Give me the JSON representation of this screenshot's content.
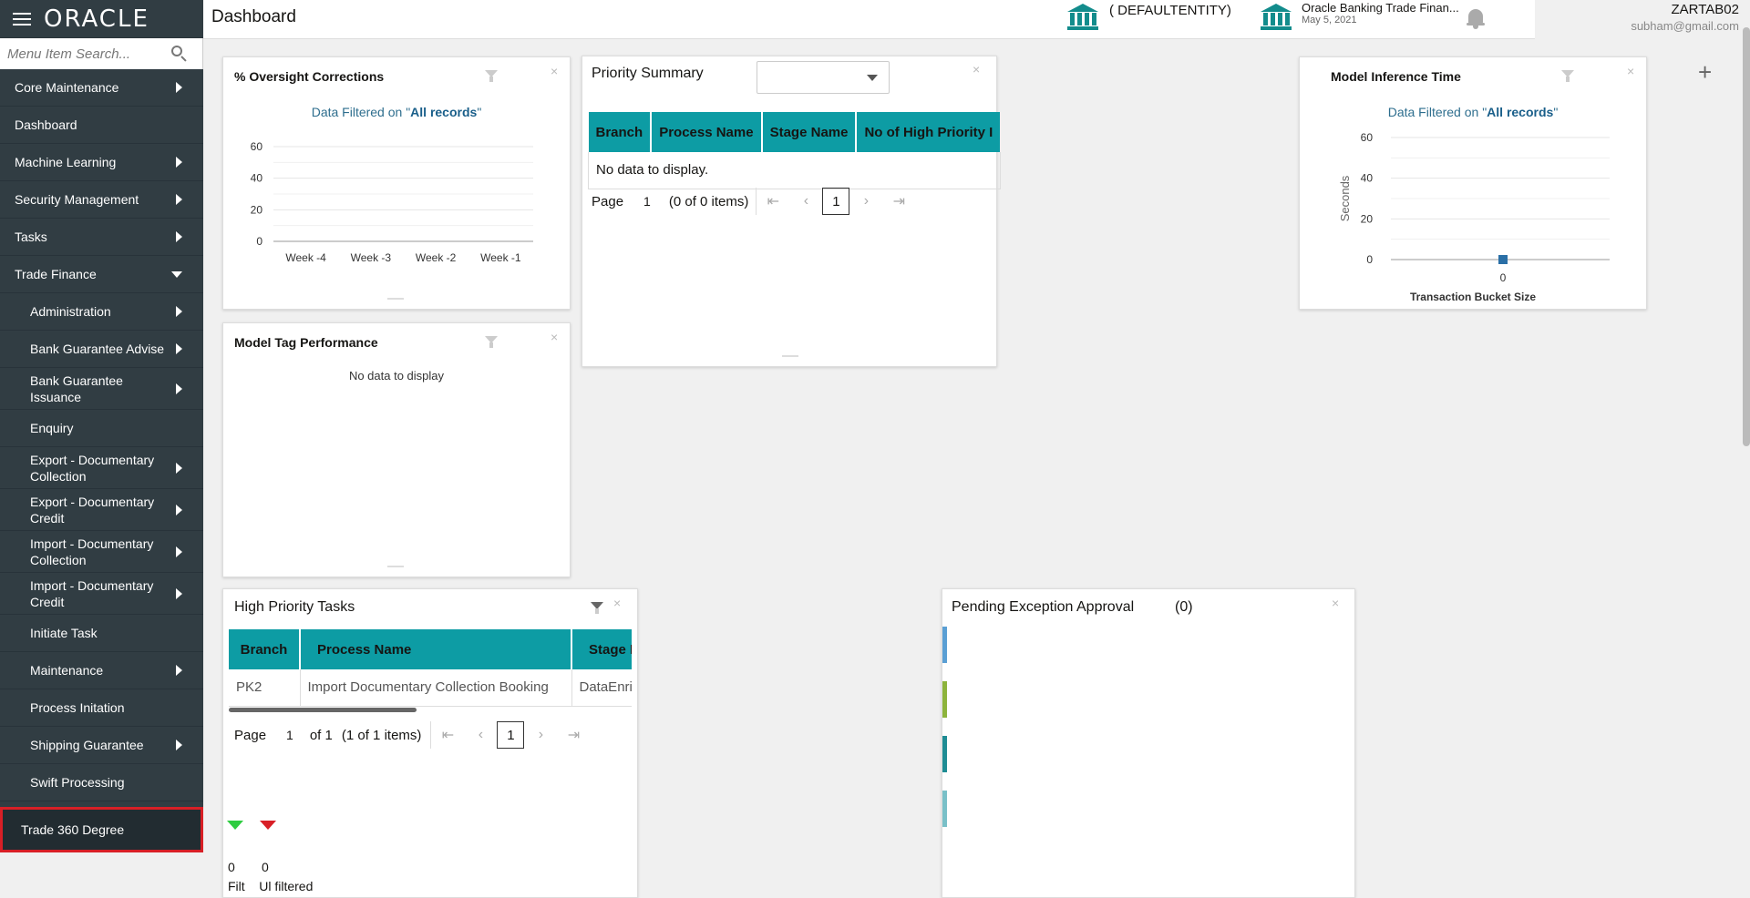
{
  "brand": {
    "logo": "ORACLE"
  },
  "search": {
    "placeholder": "Menu Item Search..."
  },
  "sidebar": {
    "items": [
      {
        "label": "Core Maintenance"
      },
      {
        "label": "Dashboard"
      },
      {
        "label": "Machine Learning"
      },
      {
        "label": "Security Management"
      },
      {
        "label": "Tasks"
      },
      {
        "label": "Trade Finance"
      },
      {
        "label": "Administration"
      },
      {
        "label": "Bank Guarantee Advise"
      },
      {
        "label": "Bank Guarantee Issuance"
      },
      {
        "label": "Enquiry"
      },
      {
        "label": "Export - Documentary Collection"
      },
      {
        "label": "Export - Documentary Credit"
      },
      {
        "label": "Import - Documentary Collection"
      },
      {
        "label": "Import - Documentary Credit"
      },
      {
        "label": "Initiate Task"
      },
      {
        "label": "Maintenance"
      },
      {
        "label": "Process Initation"
      },
      {
        "label": "Shipping Guarantee"
      },
      {
        "label": "Swift Processing"
      },
      {
        "label": "Trade 360 Degree"
      }
    ]
  },
  "header": {
    "title": "Dashboard",
    "entity": "( DEFAULTENTITY)",
    "app_name": "Oracle Banking Trade Finan...",
    "app_date": "May 5, 2021",
    "user_name": "ZARTAB02",
    "user_email": "subham@gmail.com"
  },
  "oversight": {
    "title": "% Oversight Corrections",
    "filtered_prefix": "Data Filtered on \"",
    "filtered_value": "All records",
    "filtered_suffix": "\"",
    "chart_data": {
      "type": "line",
      "categories": [
        "Week -4",
        "Week -3",
        "Week -2",
        "Week -1"
      ],
      "series": [],
      "y_ticks": [
        "0",
        "20",
        "40",
        "60"
      ],
      "ylim": [
        0,
        60
      ]
    }
  },
  "priority_summary": {
    "title": "Priority Summary",
    "columns": [
      "Branch",
      "Process Name",
      "Stage Name",
      "No of High Priority I"
    ],
    "no_data": "No data to display.",
    "page_label": "Page",
    "page_num": "1",
    "items_text": "(0 of 0 items)",
    "current_page": "1"
  },
  "model_inference": {
    "title": "Model Inference Time",
    "filtered_prefix": "Data Filtered on \"",
    "filtered_value": "All records",
    "filtered_suffix": "\"",
    "chart_data": {
      "type": "scatter",
      "y_ticks": [
        "0",
        "20",
        "40",
        "60"
      ],
      "x_ticks": [
        "0"
      ],
      "ylabel": "Seconds",
      "xlabel": "Transaction Bucket Size",
      "points": [
        {
          "x": 0,
          "y": 0
        }
      ],
      "ylim": [
        0,
        60
      ]
    }
  },
  "model_tag": {
    "title": "Model Tag Performance",
    "no_data": "No data to display"
  },
  "high_priority": {
    "title": "High Priority Tasks",
    "columns": [
      "Branch",
      "Process Name",
      "Stage I"
    ],
    "rows": [
      [
        "PK2",
        "Import Documentary Collection Booking",
        "DataEnri"
      ]
    ],
    "page_label": "Page",
    "page_num": "1",
    "of_text": "of 1",
    "items_text": "(1 of 1 items)",
    "current_page": "1",
    "count_green": "0",
    "count_red": "0",
    "cut_text": "Filt    Ul filtered"
  },
  "pending": {
    "title": "Pending Exception Approval",
    "count": "(0)",
    "bar_colors": [
      "#5a9fd4",
      "#8db43c",
      "#1e8c94",
      "#79c0c8"
    ]
  },
  "colors": {
    "teal": "#0d9ca4",
    "sidebar": "#313d43",
    "accent_red": "#d81f26"
  }
}
